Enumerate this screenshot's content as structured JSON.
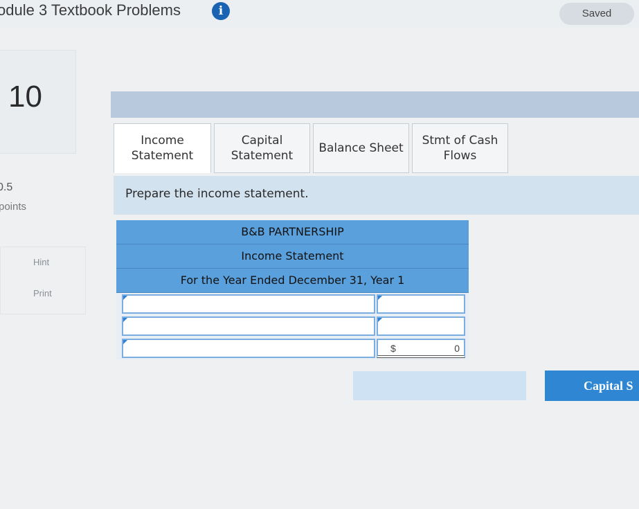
{
  "header": {
    "title": "odule 3 Textbook Problems",
    "info_icon": "info-icon",
    "saved_label": "Saved"
  },
  "question": {
    "number": "10",
    "points_value": "0.5",
    "points_label": "points",
    "hint_label": "Hint",
    "print_label": "Print"
  },
  "tabs": [
    {
      "line1": "Income",
      "line2": "Statement",
      "active": true
    },
    {
      "line1": "Capital",
      "line2": "Statement",
      "active": false
    },
    {
      "line1": "Balance Sheet",
      "line2": "",
      "active": false
    },
    {
      "line1": "Stmt of Cash",
      "line2": "Flows",
      "active": false
    }
  ],
  "instruction": "Prepare the income statement.",
  "statement": {
    "company": "B&B PARTNERSHIP",
    "name": "Income Statement",
    "period": "For the Year Ended December 31, Year 1",
    "total_currency": "$",
    "total_value": "0"
  },
  "nav": {
    "prev_label": "",
    "next_label": "Capital S"
  },
  "colors": {
    "accent": "#2f86d3",
    "header_fill": "#5aa0dc",
    "info_icon": "#1a63b3"
  }
}
